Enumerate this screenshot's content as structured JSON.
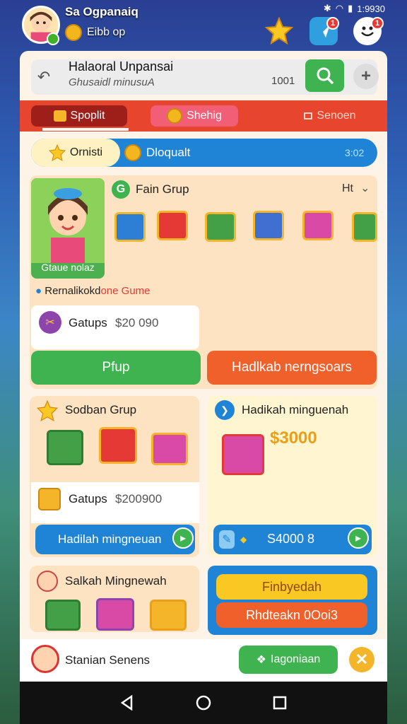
{
  "profile": {
    "name": "Sa Ogpanaiq",
    "shop_label": "Eibb op"
  },
  "status": {
    "time": "1:9930"
  },
  "notifications": {
    "count1": "1",
    "count2": "1"
  },
  "search": {
    "title": "Halaoral Unpansai",
    "subtitle": "Ghusaidl minusuA",
    "count": "1001"
  },
  "tabs": {
    "tab1": "Spoplit",
    "tab2": "Shehig",
    "tab3": "Senoen"
  },
  "subtabs": {
    "left": "Ornisti",
    "middle": "Dloqualt",
    "right": "3:02"
  },
  "group_card": {
    "title": "Fain Grup",
    "controls": "Ht",
    "avatar_caption": "Gtaue nolaz",
    "tagline_a": "Rernalikokd",
    "tagline_b": "one Gume"
  },
  "coupon": {
    "label": "Gatups",
    "value": "$20 090"
  },
  "buttons": {
    "pickup": "Pfup",
    "right_cta": "Hadlkab nerngsoars"
  },
  "sodban": {
    "title": "Sodban Grup",
    "label": "Gatups",
    "value": "$200900",
    "cta": "Hadilah mingneuan"
  },
  "hadikah": {
    "title": "Hadikah minguenah",
    "amount": "$3000",
    "cta_value": "S4000 8"
  },
  "sakah": {
    "title": "Salkah Mingnewah"
  },
  "blue_card": {
    "btn1": "Finbyedah",
    "btn2": "Rhdteakn 0Ooi3"
  },
  "bottom": {
    "name": "Stanian Senens",
    "action": "Iagoniaan"
  },
  "colors": {
    "green": "#3eb34f",
    "orange": "#f0602b",
    "red_tab": "#e8452f",
    "blue": "#1f84d6"
  }
}
